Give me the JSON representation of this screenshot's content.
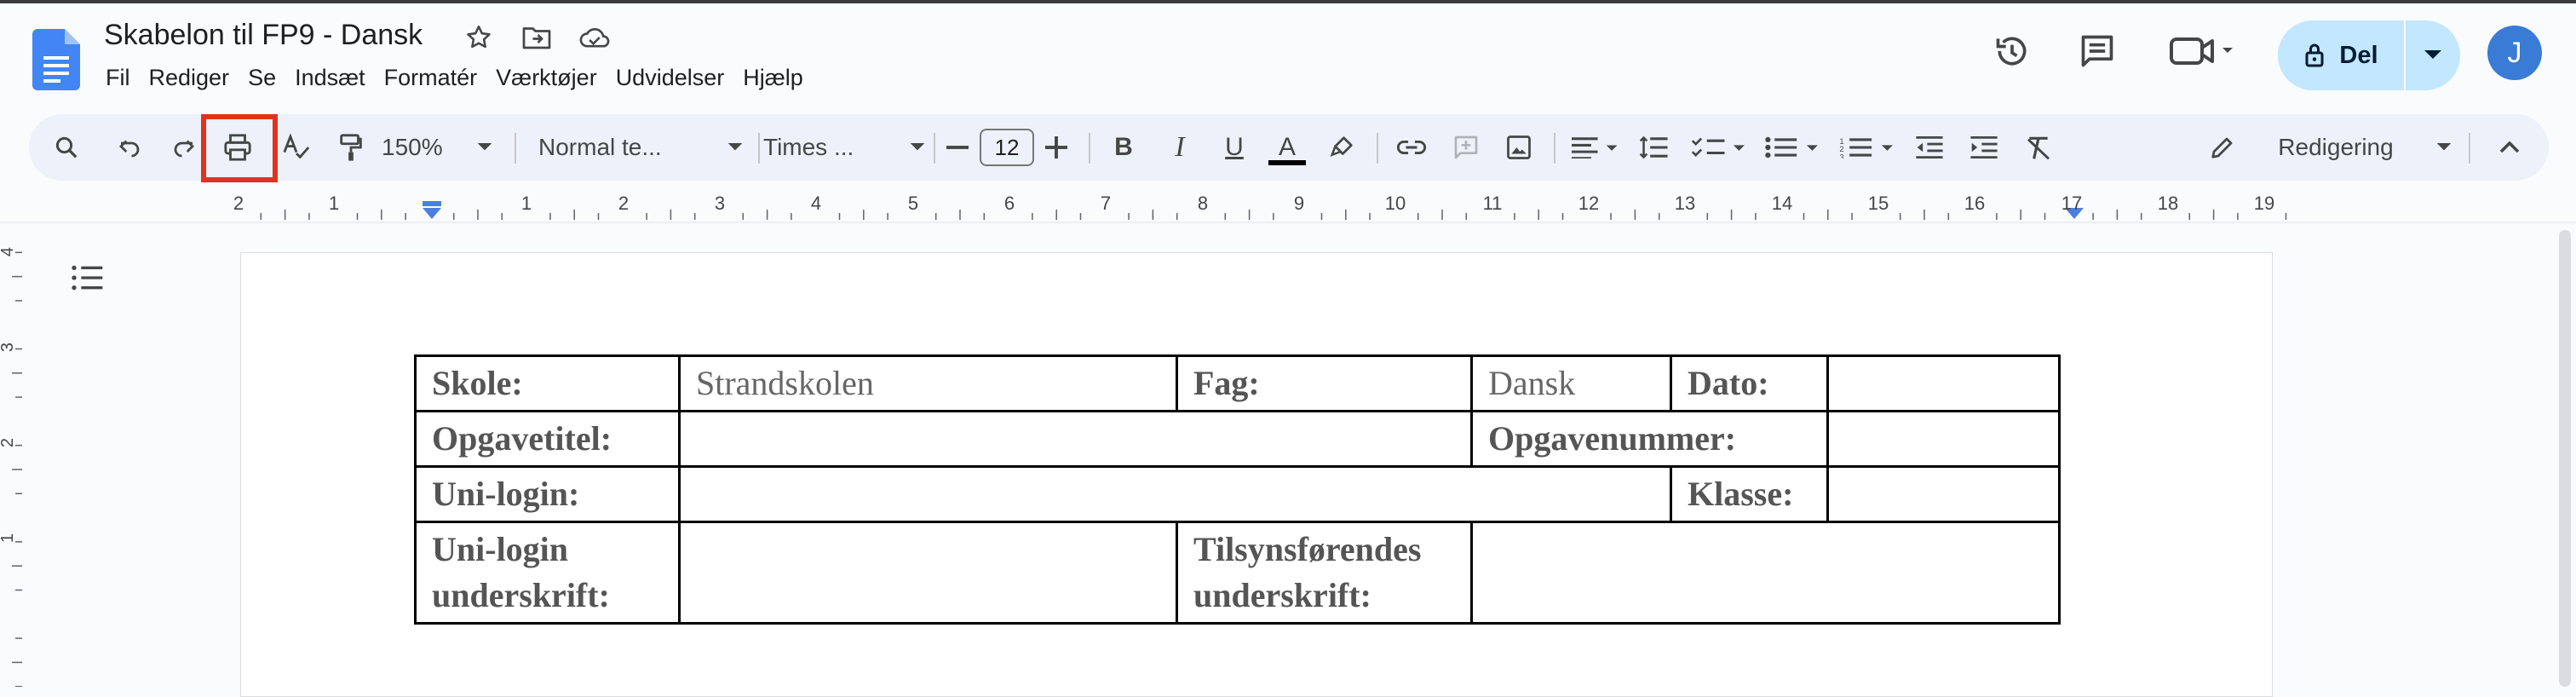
{
  "doc": {
    "title": "Skabelon til FP9 - Dansk",
    "menu": [
      "Fil",
      "Rediger",
      "Se",
      "Indsæt",
      "Formatér",
      "Værktøjer",
      "Udvidelser",
      "Hjælp"
    ]
  },
  "header_right": {
    "share_label": "Del",
    "avatar_letter": "J"
  },
  "toolbar": {
    "zoom": "150%",
    "style": "Normal te...",
    "font": "Times ...",
    "font_size": "12",
    "mode": "Redigering"
  },
  "ruler": {
    "labels": [
      "2",
      "1",
      "1",
      "2",
      "3",
      "4",
      "5",
      "6",
      "7",
      "8",
      "9",
      "10",
      "11",
      "12",
      "13",
      "14",
      "15",
      "16",
      "17",
      "18",
      "19"
    ],
    "vertical_labels": [
      "4",
      "3",
      "2",
      "1"
    ]
  },
  "form": {
    "skole_label": "Skole:",
    "skole_value": "Strandskolen",
    "fag_label": "Fag:",
    "fag_value": "Dansk",
    "dato_label": "Dato:",
    "opgavetitel_label": "Opgavetitel:",
    "opgavenummer_label": "Opgavenummer:",
    "unilogin_label": "Uni-login:",
    "klasse_label": "Klasse:",
    "unilogin_sign_label_1": "Uni-login",
    "unilogin_sign_label_2": "underskrift:",
    "tilsyn_label_1": "Tilsynsførendes",
    "tilsyn_label_2": "underskrift:"
  },
  "colors": {
    "accent": "#c2e7ff",
    "highlight": "#e2321e",
    "toolbar_bg": "#edf2fa",
    "docs_blue": "#4285f4"
  },
  "icons": [
    "docs-icon",
    "star-icon",
    "move-folder-icon",
    "cloud-status-icon",
    "history-icon",
    "comments-icon",
    "meet-icon",
    "lock-icon",
    "search-icon",
    "undo-icon",
    "redo-icon",
    "print-icon",
    "spellcheck-icon",
    "paint-format-icon",
    "bold-icon",
    "italic-icon",
    "underline-icon",
    "text-color-icon",
    "highlight-icon",
    "link-icon",
    "add-comment-icon",
    "image-icon",
    "align-icon",
    "line-spacing-icon",
    "checklist-icon",
    "bullet-list-icon",
    "numbered-list-icon",
    "decrease-indent-icon",
    "increase-indent-icon",
    "clear-format-icon",
    "pencil-icon",
    "collapse-icon",
    "outline-icon"
  ]
}
